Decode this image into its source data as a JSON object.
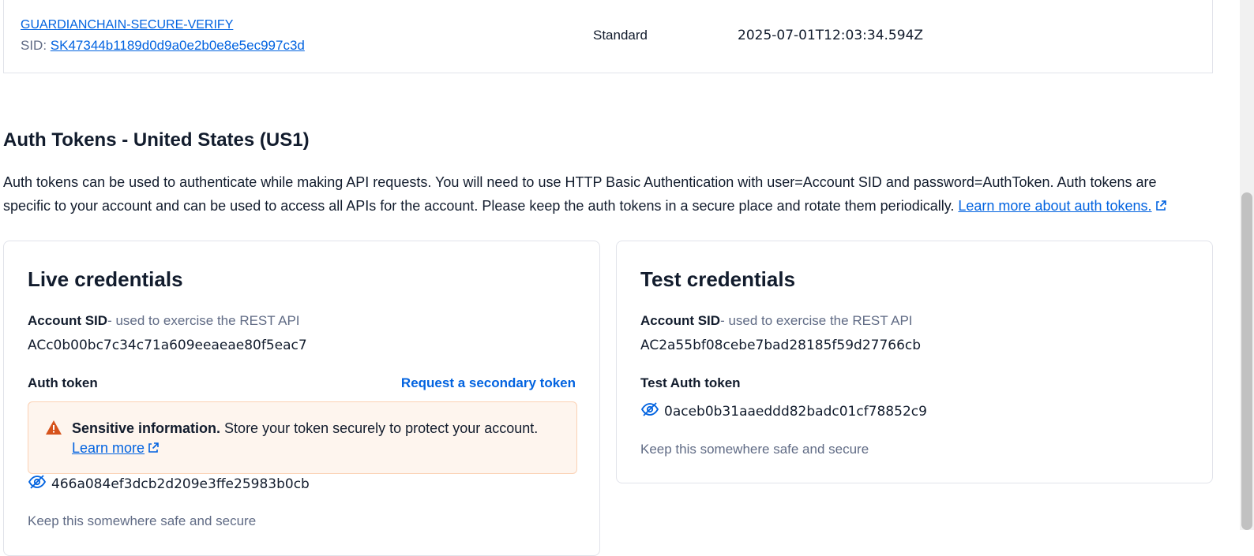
{
  "api_key_row": {
    "name": "GUARDIANCHAIN-SECURE-VERIFY",
    "sid_label": "SID: ",
    "sid": "SK47344b1189d0d9a0e2b0e8e5ec997c3d",
    "type": "Standard",
    "date_created": "2025-07-01T12:03:34.594Z"
  },
  "auth_tokens": {
    "title": "Auth Tokens - United States (US1)",
    "description": "Auth tokens can be used to authenticate while making API requests. You will need to use HTTP Basic Authentication with user=Account SID and password=AuthToken. Auth tokens are specific to your account and can be used to access all APIs for the account. Please keep the auth tokens in a secure place and rotate them periodically. ",
    "learn_more_link": "Learn more about auth tokens."
  },
  "live": {
    "title": "Live credentials",
    "account_sid_label": "Account SID",
    "account_sid_hint": "- used to exercise the REST API",
    "account_sid": "ACc0b00bc7c34c71a609eeaeae80f5eac7",
    "auth_token_label": "Auth token",
    "secondary_token_link": "Request a secondary token",
    "alert": {
      "title": "Sensitive information.",
      "body": " Store your token securely to protect your account.",
      "link": "Learn more"
    },
    "auth_token": "466a084ef3dcb2d209e3ffe25983b0cb",
    "keep_safe": "Keep this somewhere safe and secure"
  },
  "test": {
    "title": "Test credentials",
    "account_sid_label": "Account SID",
    "account_sid_hint": "- used to exercise the REST API",
    "account_sid": "AC2a55bf08cebe7bad28185f59d27766cb",
    "auth_token_label": "Test Auth token",
    "auth_token": "0aceb0b31aaeddd82badc01cf78852c9",
    "keep_safe": "Keep this somewhere safe and secure"
  },
  "icons": {
    "external_link": "external-link-icon",
    "warning": "warning-icon",
    "visibility": "eye-slash-icon"
  },
  "colors": {
    "link": "#0263e0",
    "text": "#121c2d",
    "muted": "#606b85",
    "warning_bg": "#fef5ee",
    "warning_border": "#fbd1b4",
    "warning_icon": "#d6531c"
  }
}
